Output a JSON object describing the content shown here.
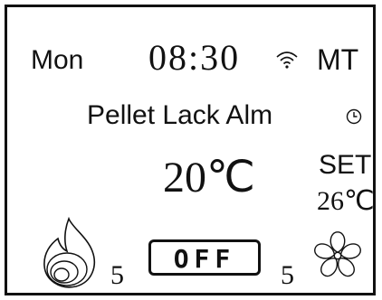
{
  "header": {
    "day": "Mon",
    "time": "08:30",
    "mode": "MT",
    "wifi_icon": "wifi-icon"
  },
  "status": {
    "alarm_text": "Pellet Lack Alm",
    "clock_icon": "clock-icon"
  },
  "temperature": {
    "room": "20℃",
    "set_label": "SET",
    "set_value": "26℃"
  },
  "controls": {
    "flame_icon": "flame-icon",
    "flame_level": "5",
    "power_label": "OFF",
    "fan_level": "5",
    "fan_icon": "fan-icon"
  },
  "colors": {
    "foreground": "#111111",
    "background": "#ffffff"
  }
}
